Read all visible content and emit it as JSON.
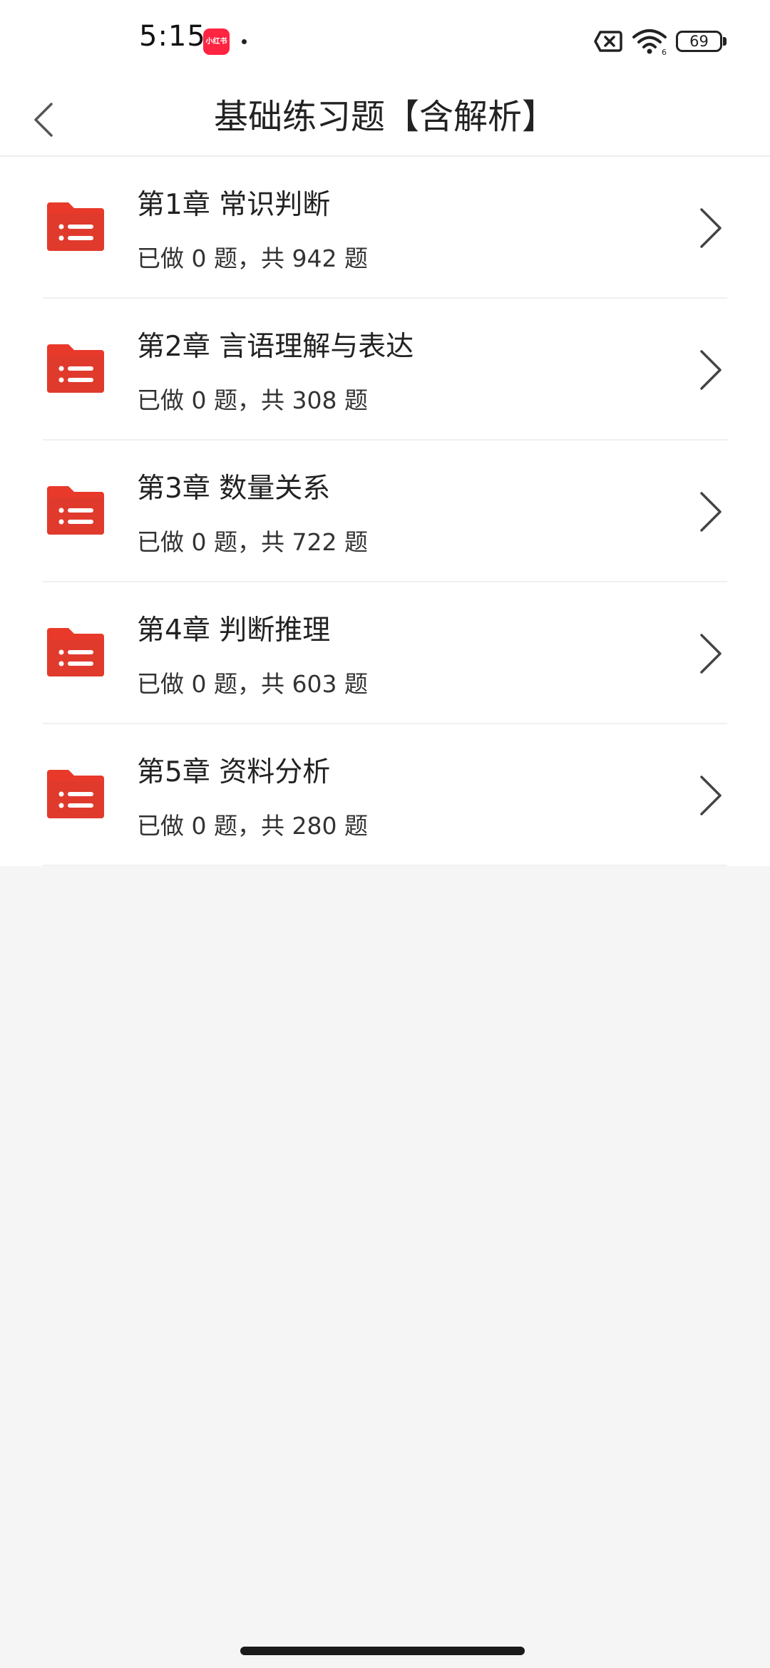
{
  "status_bar": {
    "time": "5:15",
    "app_icon_label": "小红书",
    "battery_level": "69",
    "icons": [
      "sim-disabled-icon",
      "wifi-icon",
      "battery-icon"
    ]
  },
  "header": {
    "title": "基础练习题【含解析】",
    "back_icon": "chevron-left-icon"
  },
  "chapters": [
    {
      "title": "第1章 常识判断",
      "progress": "已做 0 题，共 942 题"
    },
    {
      "title": "第2章 言语理解与表达",
      "progress": "已做 0 题，共 308 题"
    },
    {
      "title": "第3章 数量关系",
      "progress": "已做 0 题，共 722 题"
    },
    {
      "title": "第4章 判断推理",
      "progress": "已做 0 题，共 603 题"
    },
    {
      "title": "第5章 资料分析",
      "progress": "已做 0 题，共 280 题"
    }
  ],
  "colors": {
    "folder": "#e8392a",
    "background": "#f5f5f5"
  }
}
